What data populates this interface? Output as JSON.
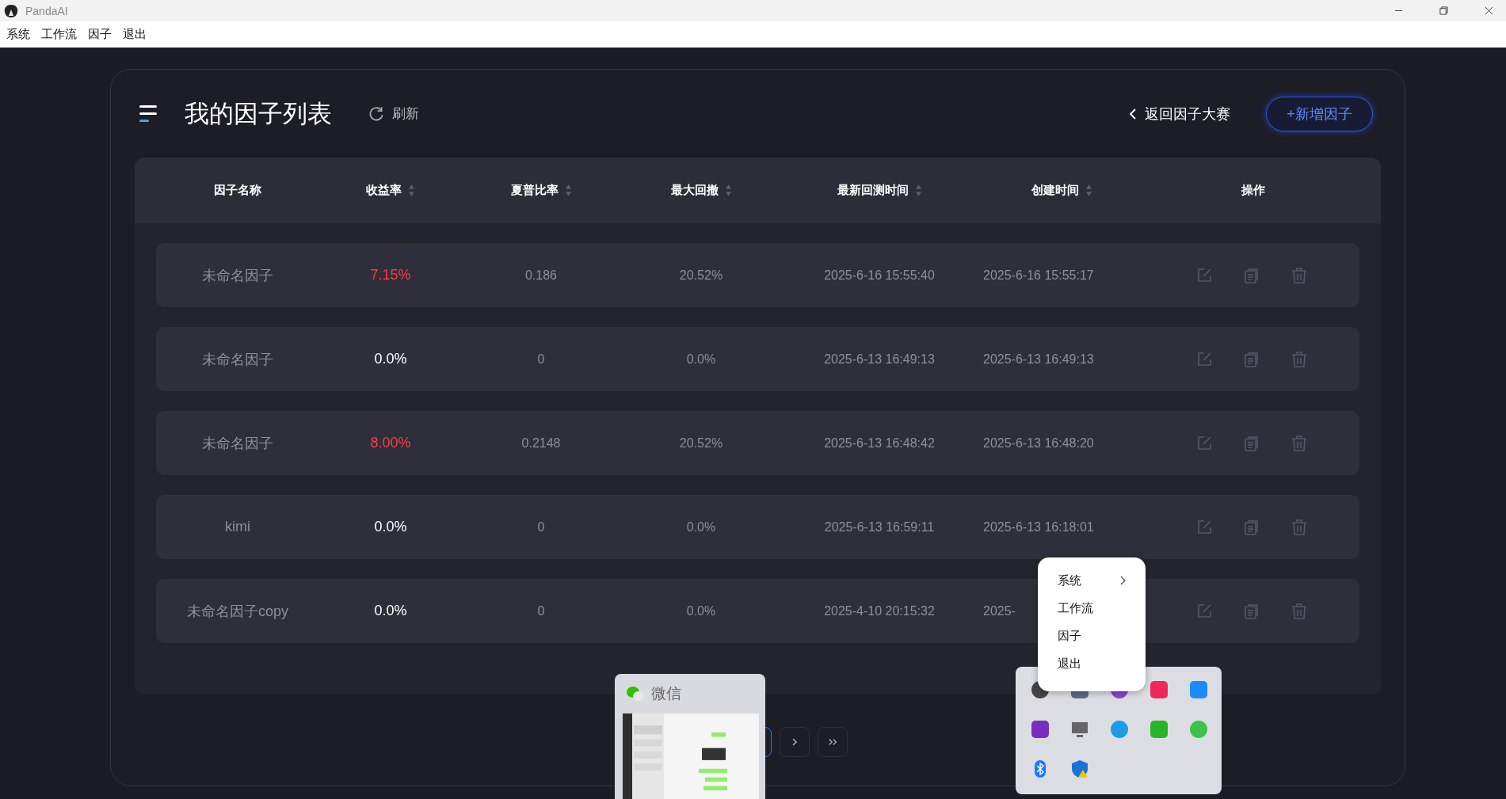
{
  "window": {
    "title": "PandaAI"
  },
  "menu_bar": [
    "系统",
    "工作流",
    "因子",
    "退出"
  ],
  "page": {
    "title": "我的因子列表",
    "refresh": "刷新",
    "back": "返回因子大赛",
    "add_button": "+新增因子"
  },
  "table": {
    "columns": [
      {
        "label": "因子名称",
        "sortable": false
      },
      {
        "label": "收益率",
        "sortable": true
      },
      {
        "label": "夏普比率",
        "sortable": true
      },
      {
        "label": "最大回撤",
        "sortable": true
      },
      {
        "label": "最新回测时间",
        "sortable": true
      },
      {
        "label": "创建时间",
        "sortable": true
      },
      {
        "label": "操作",
        "sortable": false
      }
    ],
    "rows": [
      {
        "name": "未命名因子",
        "return": "7.15%",
        "color": "#ff3b47",
        "sharpe": "0.186",
        "drawdown": "20.52%",
        "backtest_time": "2025-6-16 15:55:40",
        "created": "2025-6-16 15:55:17"
      },
      {
        "name": "未命名因子",
        "return": "0.0%",
        "color": "#ffffff",
        "sharpe": "0",
        "drawdown": "0.0%",
        "backtest_time": "2025-6-13 16:49:13",
        "created": "2025-6-13 16:49:13"
      },
      {
        "name": "未命名因子",
        "return": "8.00%",
        "color": "#ff3b47",
        "sharpe": "0.2148",
        "drawdown": "20.52%",
        "backtest_time": "2025-6-13 16:48:42",
        "created": "2025-6-13 16:48:20"
      },
      {
        "name": "kimi",
        "return": "0.0%",
        "color": "#ffffff",
        "sharpe": "0",
        "drawdown": "0.0%",
        "backtest_time": "2025-6-13 16:59:11",
        "created": "2025-6-13 16:18:01"
      },
      {
        "name": "未命名因子copy",
        "return": "0.0%",
        "color": "#ffffff",
        "sharpe": "0",
        "drawdown": "0.0%",
        "backtest_time": "2025-4-10 20:15:32",
        "created": "2025-"
      }
    ]
  },
  "context_menu": [
    {
      "label": "系统",
      "submenu": true
    },
    {
      "label": "工作流",
      "submenu": false
    },
    {
      "label": "因子",
      "submenu": false
    },
    {
      "label": "退出",
      "submenu": false
    }
  ],
  "taskbar_preview": {
    "title": "微信"
  }
}
